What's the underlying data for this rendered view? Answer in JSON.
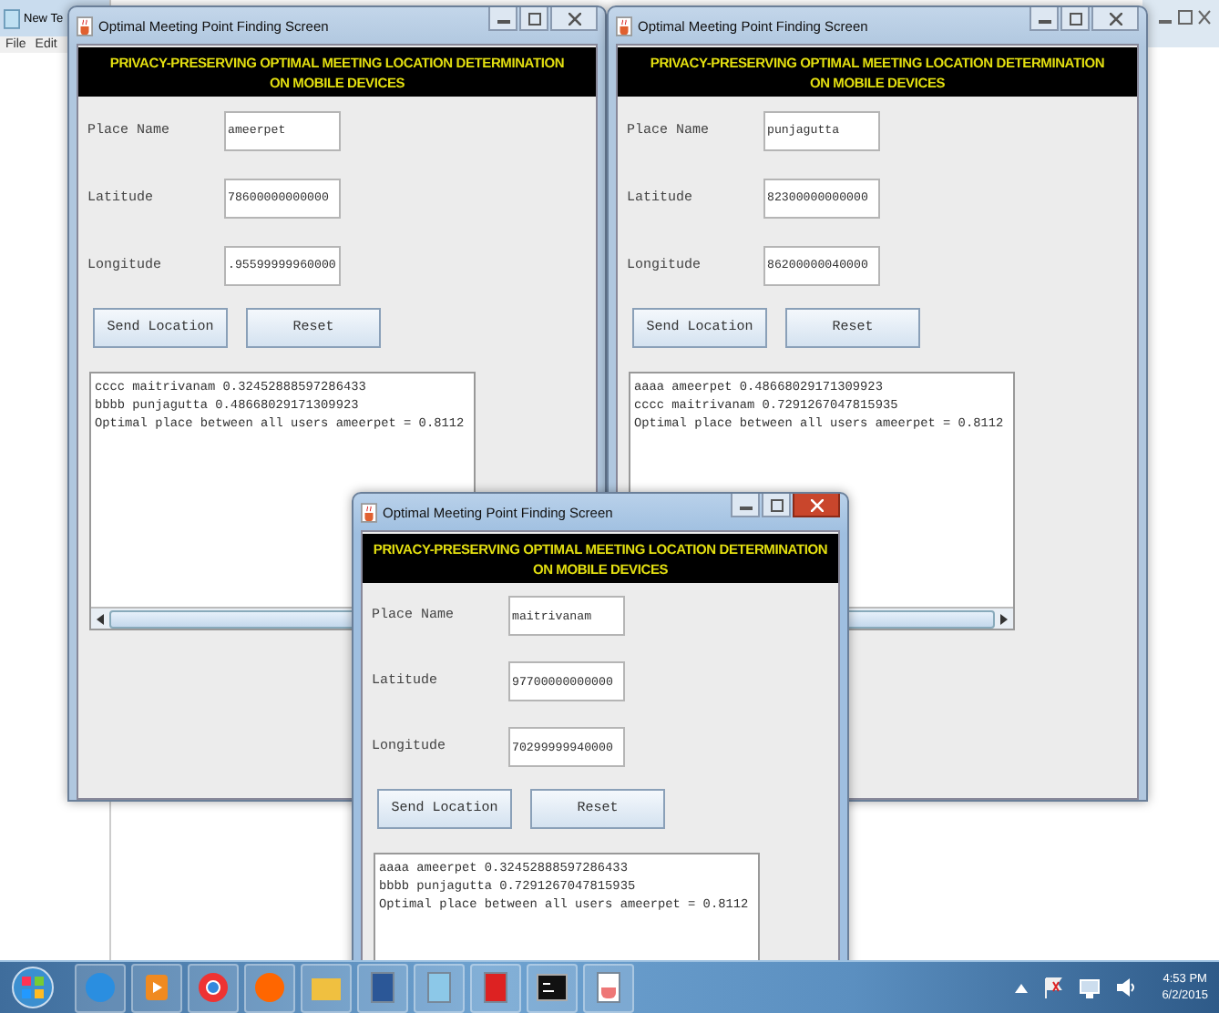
{
  "background_window": {
    "title": "New Te",
    "menu": [
      "File",
      "Edit"
    ]
  },
  "windows": [
    {
      "title": "Optimal Meeting Point Finding Screen",
      "active": false,
      "banner": [
        "PRIVACY-PRESERVING OPTIMAL MEETING LOCATION DETERMINATION",
        "ON MOBILE DEVICES"
      ],
      "fields": [
        {
          "label": "Place Name",
          "value": "ameerpet"
        },
        {
          "label": "Latitude",
          "value": "78600000000000"
        },
        {
          "label": "Longitude",
          "value": ".95599999960000"
        }
      ],
      "buttons": [
        "Send Location",
        "Reset"
      ],
      "output": [
        "cccc maitrivanam 0.32452888597286433",
        "bbbb punjagutta 0.48668029171309923",
        "Optimal place between all users ameerpet = 0.8112"
      ]
    },
    {
      "title": "Optimal Meeting Point Finding Screen",
      "active": false,
      "banner": [
        "PRIVACY-PRESERVING OPTIMAL MEETING LOCATION DETERMINATION",
        "ON MOBILE DEVICES"
      ],
      "fields": [
        {
          "label": "Place Name",
          "value": "punjagutta"
        },
        {
          "label": "Latitude",
          "value": "82300000000000"
        },
        {
          "label": "Longitude",
          "value": "86200000040000"
        }
      ],
      "buttons": [
        "Send Location",
        "Reset"
      ],
      "output": [
        "aaaa ameerpet 0.48668029171309923",
        "cccc maitrivanam 0.7291267047815935",
        "Optimal place between all users ameerpet = 0.8112"
      ]
    },
    {
      "title": "Optimal Meeting Point Finding Screen",
      "active": true,
      "banner": [
        "PRIVACY-PRESERVING OPTIMAL MEETING LOCATION DETERMINATION",
        "ON MOBILE DEVICES"
      ],
      "fields": [
        {
          "label": "Place Name",
          "value": "maitrivanam"
        },
        {
          "label": "Latitude",
          "value": "97700000000000"
        },
        {
          "label": "Longitude",
          "value": "70299999940000"
        }
      ],
      "buttons": [
        "Send Location",
        "Reset"
      ],
      "output": [
        "aaaa ameerpet 0.32452888597286433",
        "bbbb punjagutta 0.7291267047815935",
        "Optimal place between all users ameerpet = 0.8112"
      ]
    }
  ],
  "taskbar": {
    "time": "4:53 PM",
    "date": "6/2/2015"
  }
}
